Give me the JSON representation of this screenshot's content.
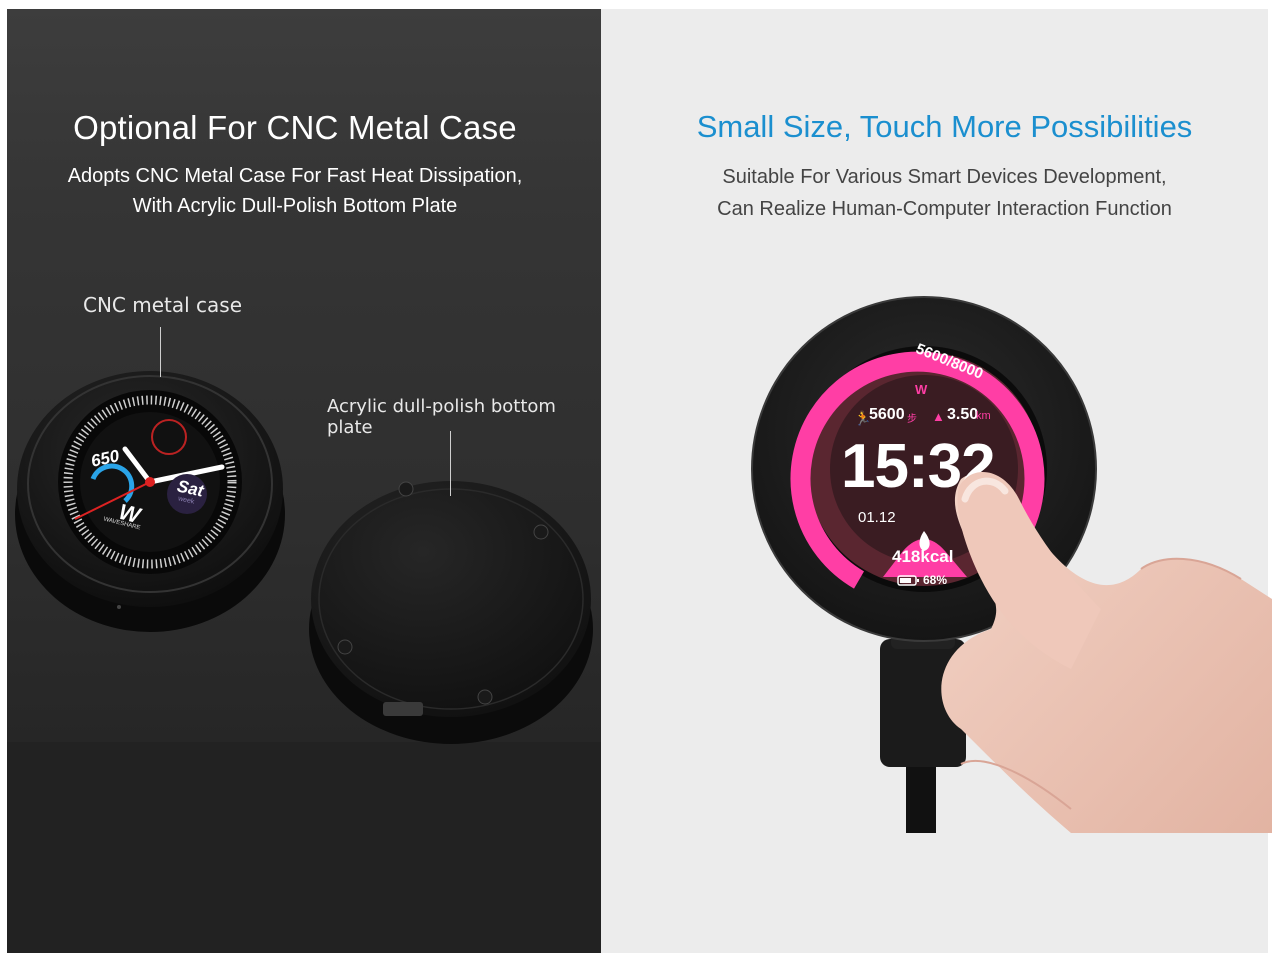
{
  "left": {
    "title": "Optional For CNC Metal Case",
    "subtitle_line1": "Adopts CNC Metal Case For Fast Heat Dissipation,",
    "subtitle_line2": "With Acrylic Dull-Polish Bottom Plate",
    "callout_case": "CNC metal case",
    "callout_plate": "Acrylic dull-polish bottom plate",
    "watch_face": {
      "steps_value": "650",
      "day": "Sat",
      "day_sub": "week",
      "brand": "WAVESHARE"
    }
  },
  "right": {
    "title": "Small Size, Touch More Possibilities",
    "subtitle_line1": "Suitable For Various Smart Devices Development,",
    "subtitle_line2": "Can Realize Human-Computer Interaction Function",
    "screen": {
      "arc_text": "5600/8000",
      "steps": "5600",
      "steps_unit": "步",
      "distance": "3.50",
      "distance_unit": "km",
      "time": "15:32",
      "date": "01.12",
      "calories": "418kcal",
      "battery": "68%"
    }
  },
  "colors": {
    "title_blue": "#1b8fcf",
    "screen_pink": "#ff3ea5",
    "screen_bg": "#5a2630"
  }
}
